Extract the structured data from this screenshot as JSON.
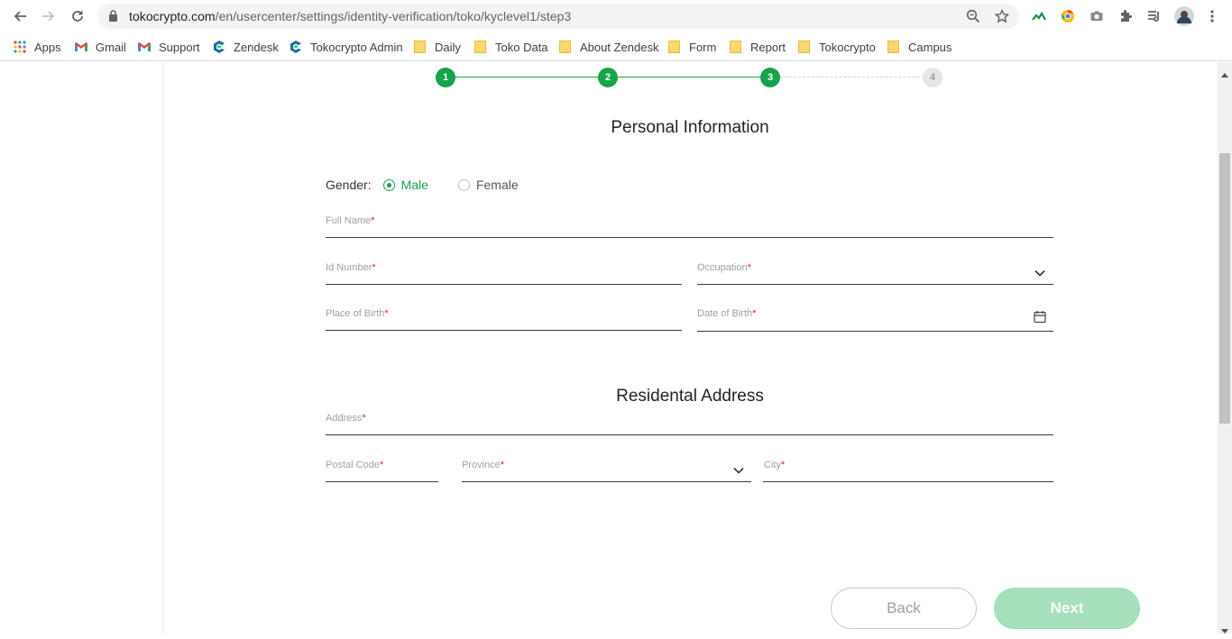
{
  "browser": {
    "url_host": "tokocrypto.com",
    "url_path": "/en/usercenter/settings/identity-verification/toko/kyclevel1/step3"
  },
  "bookmarks": [
    {
      "label": "Apps",
      "icon": "apps-grid-icon"
    },
    {
      "label": "Gmail",
      "icon": "gmail-icon"
    },
    {
      "label": "Support",
      "icon": "gmail-icon"
    },
    {
      "label": "Zendesk",
      "icon": "tokocrypto-logo-icon"
    },
    {
      "label": "Tokocrypto Admin",
      "icon": "tokocrypto-logo-icon"
    },
    {
      "label": "Daily",
      "icon": "folder-icon"
    },
    {
      "label": "Toko Data",
      "icon": "folder-icon"
    },
    {
      "label": "About Zendesk",
      "icon": "folder-icon"
    },
    {
      "label": "Form",
      "icon": "folder-icon"
    },
    {
      "label": "Report",
      "icon": "folder-icon"
    },
    {
      "label": "Tokocrypto",
      "icon": "folder-icon"
    },
    {
      "label": "Campus",
      "icon": "folder-icon"
    }
  ],
  "stepper": {
    "steps": [
      "1",
      "2",
      "3",
      "4"
    ],
    "current_step": 3,
    "accent": "#16a34a"
  },
  "personal": {
    "title": "Personal Information",
    "gender_label": "Gender:",
    "gender_options": [
      "Male",
      "Female"
    ],
    "gender_selected": "Male",
    "full_name": "Full Name",
    "id_number": "Id Number",
    "occupation": "Occupation",
    "place_of_birth": "Place of Birth",
    "date_of_birth": "Date of Birth",
    "required_mark": "*"
  },
  "address": {
    "title": "Residental Address",
    "address": "Address",
    "postal_code": "Postal Code",
    "province": "Province",
    "city": "City"
  },
  "buttons": {
    "back": "Back",
    "next": "Next"
  }
}
